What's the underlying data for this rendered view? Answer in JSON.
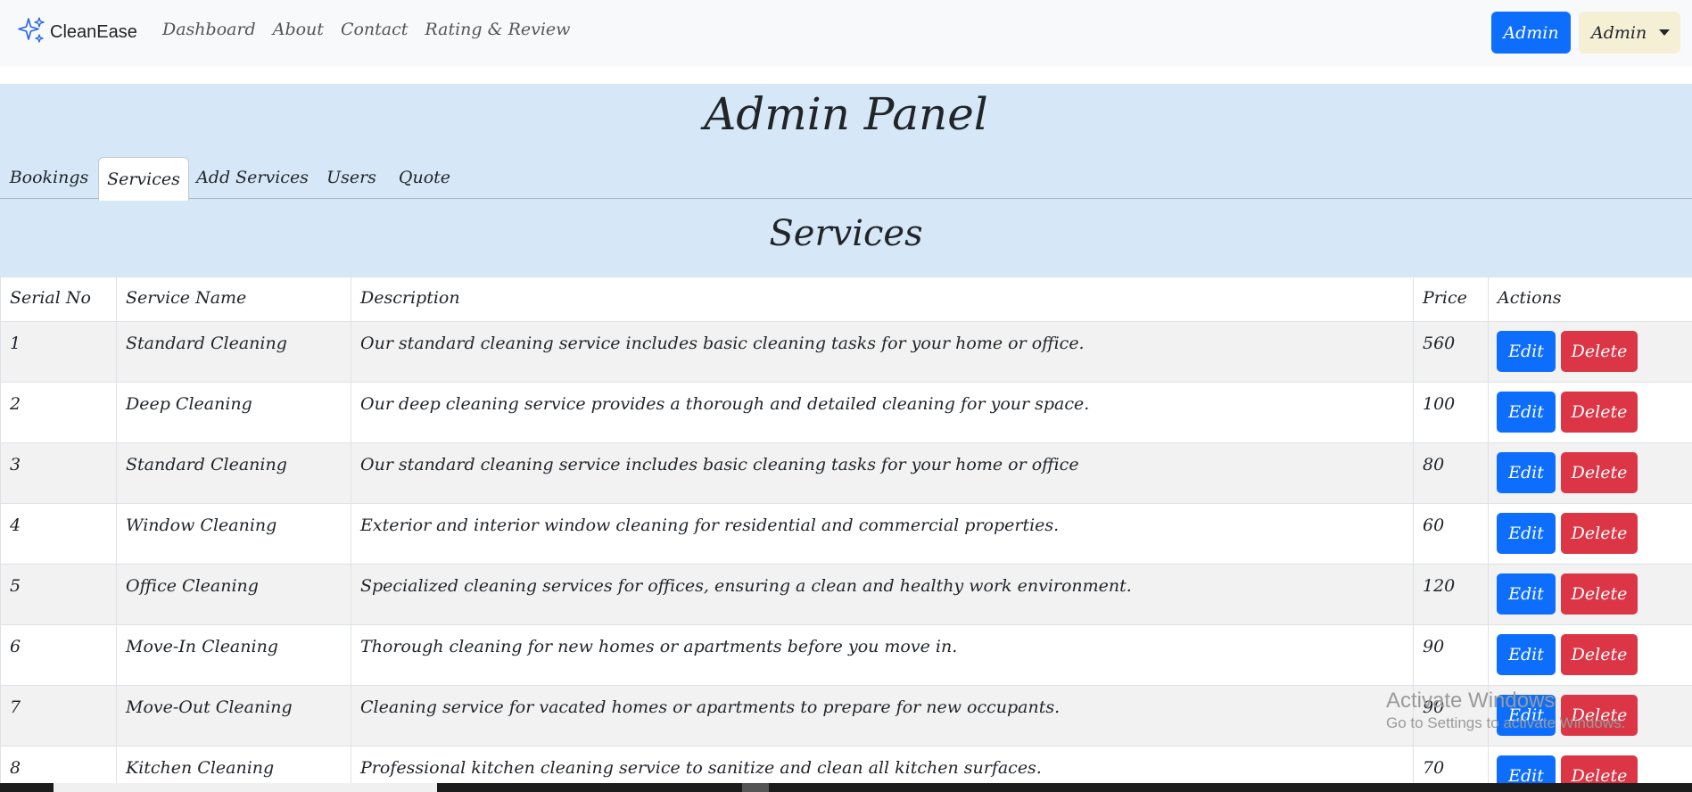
{
  "navbar": {
    "brand": "CleanEase",
    "links": [
      "Dashboard",
      "About",
      "Contact",
      "Rating & Review"
    ],
    "admin_button": "Admin",
    "admin_dropdown": "Admin"
  },
  "panel": {
    "title": "Admin Panel",
    "tabs": [
      "Bookings",
      "Services",
      "Add Services",
      "Users",
      "Quote"
    ],
    "active_tab": "Services",
    "section_title": "Services"
  },
  "table": {
    "headers": [
      "Serial No",
      "Service Name",
      "Description",
      "Price",
      "Actions"
    ],
    "rows": [
      {
        "serial": "1",
        "name": "Standard Cleaning",
        "description": "Our standard cleaning service includes basic cleaning tasks for your home or office.",
        "price": "560"
      },
      {
        "serial": "2",
        "name": "Deep Cleaning",
        "description": "Our deep cleaning service provides a thorough and detailed cleaning for your space.",
        "price": "100"
      },
      {
        "serial": "3",
        "name": "Standard Cleaning",
        "description": "Our standard cleaning service includes basic cleaning tasks for your home or office",
        "price": "80"
      },
      {
        "serial": "4",
        "name": "Window Cleaning",
        "description": "Exterior and interior window cleaning for residential and commercial properties.",
        "price": "60"
      },
      {
        "serial": "5",
        "name": "Office Cleaning",
        "description": "Specialized cleaning services for offices, ensuring a clean and healthy work environment.",
        "price": "120"
      },
      {
        "serial": "6",
        "name": "Move-In Cleaning",
        "description": "Thorough cleaning for new homes or apartments before you move in.",
        "price": "90"
      },
      {
        "serial": "7",
        "name": "Move-Out Cleaning",
        "description": "Cleaning service for vacated homes or apartments to prepare for new occupants.",
        "price": "90"
      },
      {
        "serial": "8",
        "name": "Kitchen Cleaning",
        "description": "Professional kitchen cleaning service to sanitize and clean all kitchen surfaces.",
        "price": "70"
      }
    ],
    "edit_label": "Edit",
    "delete_label": "Delete"
  },
  "watermark": {
    "title": "Activate Windows",
    "subtitle": "Go to Settings to activate Windows."
  },
  "colors": {
    "primary": "#0d6efd",
    "danger": "#dc3545",
    "panel_bg": "#d6e8f7",
    "navbar_bg": "#f8f9fa"
  },
  "icons": {
    "brand": "sparkles-icon",
    "dropdown": "caret-down-icon"
  }
}
